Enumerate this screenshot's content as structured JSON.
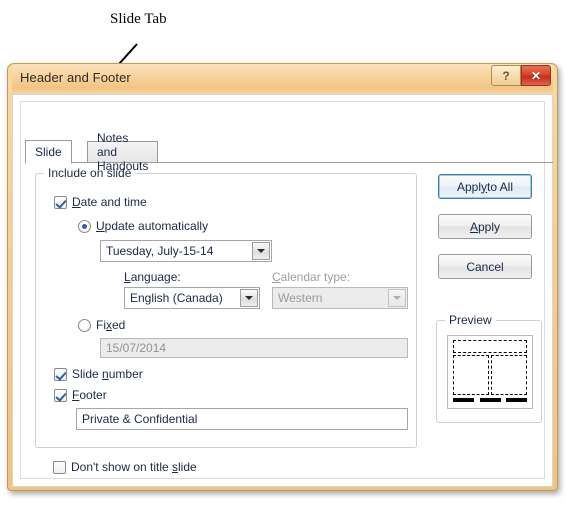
{
  "annotation": {
    "label": "Slide Tab"
  },
  "dialog": {
    "title": "Header and Footer",
    "titlebar_buttons": {
      "help": "?",
      "close": "✕"
    }
  },
  "tabs": [
    {
      "label": "Slide",
      "active": true
    },
    {
      "label": "Notes and Handouts",
      "active": false
    }
  ],
  "groups": {
    "include_on_slide": "Include on slide",
    "preview": "Preview"
  },
  "form": {
    "date_and_time": {
      "label_pre": "D",
      "label_accel": "D",
      "label_full": "Date and time",
      "checked": true
    },
    "update_automatically": {
      "label_full": "Update automatically",
      "selected": true,
      "date_value": "Tuesday, July-15-14"
    },
    "language": {
      "label": "Language:",
      "value": "English (Canada)",
      "disabled": false
    },
    "calendar_type": {
      "label": "Calendar type:",
      "value": "Western",
      "disabled": true
    },
    "fixed": {
      "label_full": "Fixed",
      "selected": false,
      "value": "15/07/2014",
      "disabled": true
    },
    "slide_number": {
      "label_full": "Slide number",
      "checked": true
    },
    "footer": {
      "label_full": "Footer",
      "checked": true,
      "value": "Private & Confidential"
    },
    "dont_show_on_title_slide": {
      "label_full": "Don't show on title slide",
      "checked": false
    }
  },
  "buttons": {
    "apply_to_all": "Apply to All",
    "apply": "Apply",
    "cancel": "Cancel"
  },
  "colors": {
    "titlebar_accent": "#f2c483",
    "close_button": "#c22e18",
    "default_button_focus": "#3c7fb1",
    "check_mark": "#2b5fa8",
    "label_text": "#1b2a47"
  }
}
